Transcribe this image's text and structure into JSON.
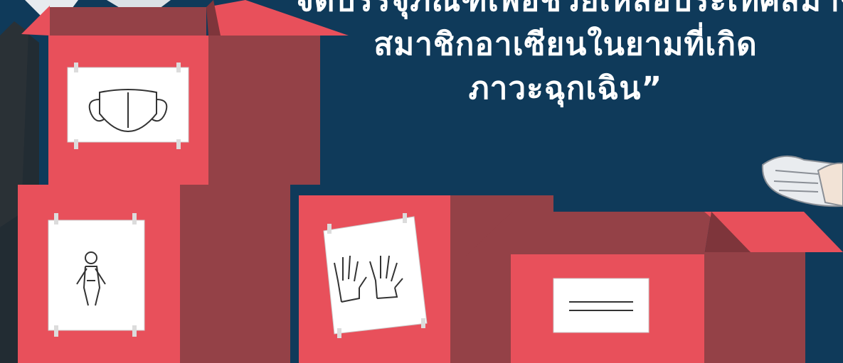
{
  "quote": {
    "lines": [
      "จัดบรรจุภัณฑ์เพื่อช่วยเหลือประเทศสมาชิก",
      "สมาชิกอาเซียนในยามที่เกิด",
      "ภาวะฉุกเฉิน”"
    ]
  },
  "labels": {
    "box1": "mask-icon",
    "box2": "protective-suit-icon",
    "box3": "gloves-icon",
    "box4": "blank-label-icon"
  },
  "colors": {
    "background": "#0f3a5a",
    "box_front": "#e8505b",
    "box_side": "#944147",
    "paper": "#ffffff",
    "tape": "#dcdcdc",
    "glove": "#e9ecef"
  }
}
